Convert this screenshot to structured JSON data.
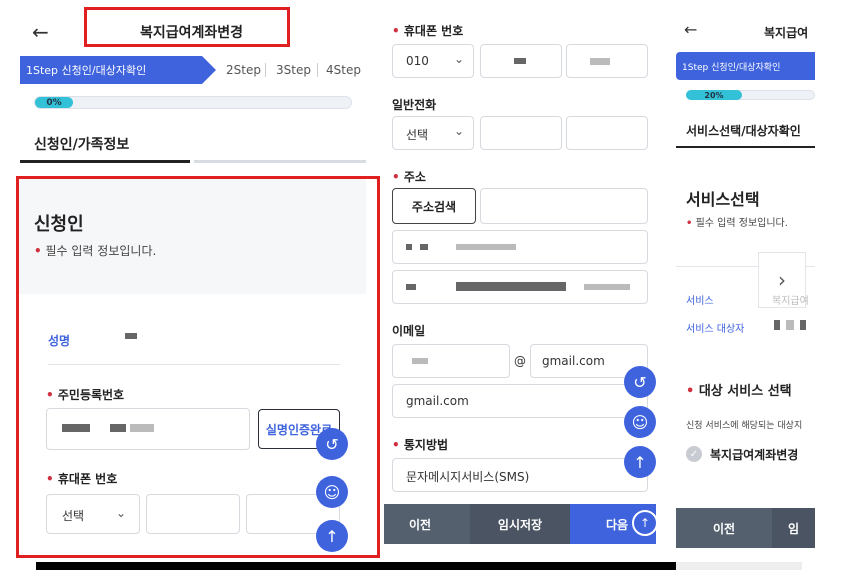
{
  "colors": {
    "primary": "#3e63dd",
    "progress": "#33c1d8",
    "required_dot": "#d03040",
    "highlight_box": "#e02020",
    "bottom_bar_gray": "#55606e"
  },
  "panel1": {
    "header_title": "복지급여계좌변경",
    "steps": [
      "1Step 신청인/대상자확인",
      "2Step",
      "3Step",
      "4Step"
    ],
    "progress_label": "0%",
    "progress_value": 0,
    "tabs": [
      "신청인/가족정보"
    ],
    "section_title": "신청인",
    "required_note": "필수 입력 정보입니다.",
    "name_label": "성명",
    "rrn_label": "주민등록번호",
    "verify_button": "실명인증완료",
    "phone_label": "휴대폰 번호",
    "phone_select": "선택"
  },
  "panel2": {
    "mobile_label": "휴대폰 번호",
    "mobile_select": "010",
    "landline_label": "일반전화",
    "landline_select": "선택",
    "address_label": "주소",
    "address_search_button": "주소검색",
    "email_label": "이메일",
    "email_at": "@",
    "email_domain": "gmail.com",
    "email_domain_select": "gmail.com",
    "notify_label": "통지방법",
    "notify_select": "문자메시지서비스(SMS)",
    "bottom_prev": "이전",
    "bottom_temp": "임시저장",
    "bottom_next": "다음"
  },
  "panel3": {
    "header_title": "복지급여",
    "step_label": "1Step 신청인/대상자확인",
    "progress_label": "20%",
    "progress_value": 20,
    "tab_label": "서비스선택/대상자확인",
    "section_title": "서비스선택",
    "required_note": "필수 입력 정보입니다.",
    "service_label": "서비스",
    "service_value": "복지급여",
    "target_label": "서비스 대상자",
    "select_title": "대상 서비스 선택",
    "select_desc": "신청 서비스에 해당되는 대상지",
    "checked_item": "복지급여계좌변경",
    "bottom_prev": "이전",
    "bottom_next": "임"
  }
}
